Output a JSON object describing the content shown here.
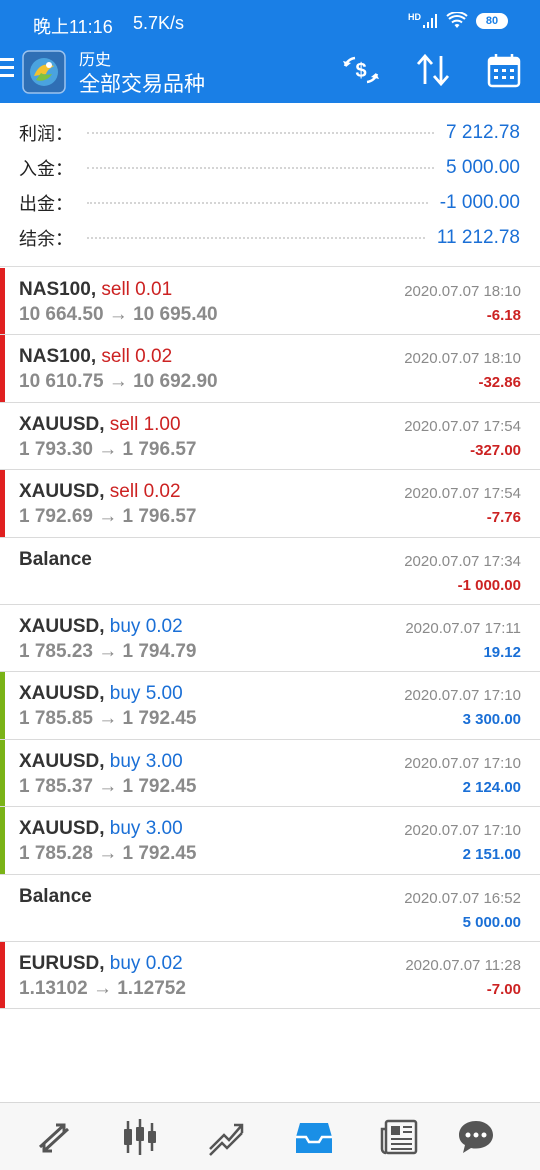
{
  "status_bar": {
    "time": "晚上11:16",
    "speed": "5.7K/s",
    "network": "HD",
    "battery": "80"
  },
  "header": {
    "title_small": "历史",
    "title_big": "全部交易品种"
  },
  "summary": [
    {
      "label": "利润：",
      "value": "7 212.78"
    },
    {
      "label": "入金：",
      "value": "5 000.00"
    },
    {
      "label": "出金：",
      "value": "-1 000.00"
    },
    {
      "label": "结余：",
      "value": "11 212.78"
    }
  ],
  "trades": [
    {
      "symbol": "NAS100,",
      "side": "sell 0.01",
      "side_type": "sell",
      "prices": "10 664.50 → 10 695.40",
      "datetime": "2020.07.07 18:10",
      "profit": "-6.18",
      "profit_sign": "neg",
      "bar": "red"
    },
    {
      "symbol": "NAS100,",
      "side": "sell 0.02",
      "side_type": "sell",
      "prices": "10 610.75 → 10 692.90",
      "datetime": "2020.07.07 18:10",
      "profit": "-32.86",
      "profit_sign": "neg",
      "bar": "red"
    },
    {
      "symbol": "XAUUSD,",
      "side": "sell 1.00",
      "side_type": "sell",
      "prices": "1 793.30 → 1 796.57",
      "datetime": "2020.07.07 17:54",
      "profit": "-327.00",
      "profit_sign": "neg",
      "bar": "none"
    },
    {
      "symbol": "XAUUSD,",
      "side": "sell 0.02",
      "side_type": "sell",
      "prices": "1 792.69 → 1 796.57",
      "datetime": "2020.07.07 17:54",
      "profit": "-7.76",
      "profit_sign": "neg",
      "bar": "red"
    },
    {
      "symbol": "Balance",
      "side": "",
      "side_type": "",
      "prices": "",
      "datetime": "2020.07.07 17:34",
      "profit": "-1 000.00",
      "profit_sign": "neg",
      "bar": "none"
    },
    {
      "symbol": "XAUUSD,",
      "side": "buy 0.02",
      "side_type": "buy",
      "prices": "1 785.23 → 1 794.79",
      "datetime": "2020.07.07 17:11",
      "profit": "19.12",
      "profit_sign": "pos",
      "bar": "none"
    },
    {
      "symbol": "XAUUSD,",
      "side": "buy 5.00",
      "side_type": "buy",
      "prices": "1 785.85 → 1 792.45",
      "datetime": "2020.07.07 17:10",
      "profit": "3 300.00",
      "profit_sign": "pos",
      "bar": "green"
    },
    {
      "symbol": "XAUUSD,",
      "side": "buy 3.00",
      "side_type": "buy",
      "prices": "1 785.37 → 1 792.45",
      "datetime": "2020.07.07 17:10",
      "profit": "2 124.00",
      "profit_sign": "pos",
      "bar": "green"
    },
    {
      "symbol": "XAUUSD,",
      "side": "buy 3.00",
      "side_type": "buy",
      "prices": "1 785.28 → 1 792.45",
      "datetime": "2020.07.07 17:10",
      "profit": "2 151.00",
      "profit_sign": "pos",
      "bar": "green"
    },
    {
      "symbol": "Balance",
      "side": "",
      "side_type": "",
      "prices": "",
      "datetime": "2020.07.07 16:52",
      "profit": "5 000.00",
      "profit_sign": "pos",
      "bar": "none"
    },
    {
      "symbol": "EURUSD,",
      "side": "buy 0.02",
      "side_type": "buy",
      "prices": "1.13102 → 1.12752",
      "datetime": "2020.07.07 11:28",
      "profit": "-7.00",
      "profit_sign": "neg",
      "bar": "red"
    }
  ],
  "colors": {
    "header_bg": "#1a7fe6",
    "sell": "#cc2222",
    "buy": "#1a6fd6",
    "bar_red": "#e02020",
    "bar_green": "#7ab317",
    "nav_active": "#1a8fe6",
    "nav_inactive": "#555555"
  },
  "bottom_nav": [
    {
      "icon": "quotes-icon",
      "active": false
    },
    {
      "icon": "chart-icon",
      "active": false
    },
    {
      "icon": "trade-icon",
      "active": false
    },
    {
      "icon": "history-icon",
      "active": true
    },
    {
      "icon": "news-icon",
      "active": false
    },
    {
      "icon": "messages-icon",
      "active": false
    }
  ]
}
